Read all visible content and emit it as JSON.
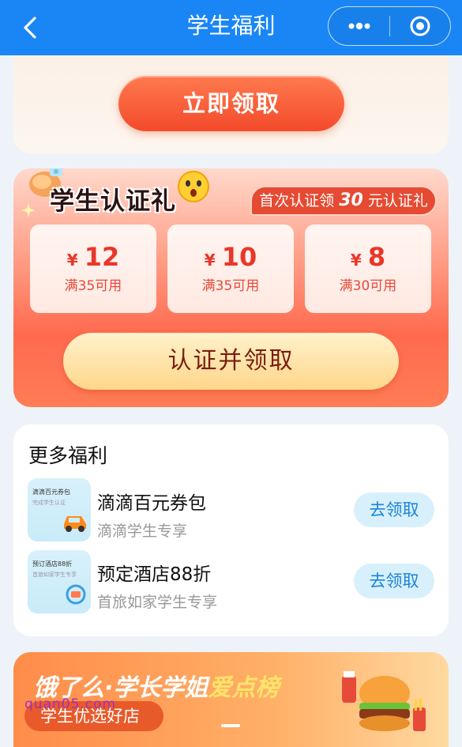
{
  "nav": {
    "title": "学生福利"
  },
  "top": {
    "claim_label": "立即领取"
  },
  "cert": {
    "title": "学生认证礼",
    "first_prefix": "首次认证领",
    "first_amount": "30",
    "first_suffix": "元认证礼",
    "coupons": [
      {
        "currency": "¥",
        "amount": "12",
        "condition": "满35可用"
      },
      {
        "currency": "¥",
        "amount": "10",
        "condition": "满35可用"
      },
      {
        "currency": "¥",
        "amount": "8",
        "condition": "满30可用"
      }
    ],
    "button_label": "认证并领取"
  },
  "more": {
    "title": "更多福利",
    "items": [
      {
        "title": "滴滴百元券包",
        "subtitle": "滴滴学生专享",
        "button": "去领取",
        "thumb_title": "滴滴百元券包",
        "thumb_sub": "完成学生认证"
      },
      {
        "title": "预定酒店88折",
        "subtitle": "首旅如家学生专享",
        "button": "去领取",
        "thumb_title": "预订酒店88折",
        "thumb_sub": "首旅如家学生专享"
      }
    ]
  },
  "banner": {
    "title_a": "饿了么·学长学姐",
    "title_b": "爱点榜",
    "pill": "学生优选好店",
    "watermark": "quan05.com"
  },
  "colors": {
    "nav": "#1a86f5",
    "accent_red": "#e8372a",
    "link_blue": "#1a84d8"
  }
}
